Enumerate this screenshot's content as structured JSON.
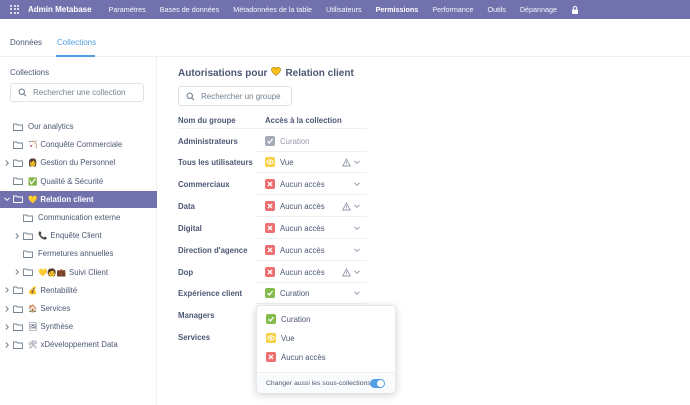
{
  "topnav": {
    "brand": "Admin Metabase",
    "items": [
      "Paramètres",
      "Bases de données",
      "Métadonnées de la table",
      "Utilisateurs",
      "Permissions",
      "Performance",
      "Outils",
      "Dépannage"
    ],
    "active": "Permissions",
    "bg_color": "#7172ad"
  },
  "subtabs": {
    "items": [
      "Données",
      "Collections"
    ],
    "active": "Collections",
    "accent": "#509ee3"
  },
  "sidebar": {
    "title": "Collections",
    "search_placeholder": "Rechercher une collection",
    "items": [
      {
        "label": "Our analytics",
        "emoji": "",
        "expandable": false,
        "level": 0
      },
      {
        "label": "Conquête Commerciale",
        "emoji": "🏹",
        "expandable": false,
        "level": 0
      },
      {
        "label": "Gestion du Personnel",
        "emoji": "👩",
        "expandable": true,
        "level": 0
      },
      {
        "label": "Qualité & Sécurité",
        "emoji": "✅",
        "expandable": false,
        "level": 0
      },
      {
        "label": "Relation client",
        "emoji": "💛",
        "expandable": true,
        "level": 0,
        "selected": true
      },
      {
        "label": "Communication externe",
        "emoji": "",
        "expandable": false,
        "level": 1
      },
      {
        "label": "Enquête Client",
        "emoji": "📞",
        "expandable": true,
        "level": 1
      },
      {
        "label": "Fermetures annuelles",
        "emoji": "",
        "expandable": false,
        "level": 1
      },
      {
        "label": "Suivi Client",
        "emoji": "💛🧑💼",
        "expandable": true,
        "level": 1
      },
      {
        "label": "Rentabilité",
        "emoji": "💰",
        "expandable": true,
        "level": 0
      },
      {
        "label": "Services",
        "emoji": "🏠",
        "expandable": true,
        "level": 0
      },
      {
        "label": "Synthèse",
        "emoji": "🖼",
        "expandable": true,
        "level": 0
      },
      {
        "label": "xDéveloppement Data",
        "emoji": "🛠",
        "expandable": true,
        "level": 0
      }
    ]
  },
  "main": {
    "title_prefix": "Autorisations pour",
    "title_emoji": "💛",
    "title_name": "Relation client",
    "search_placeholder": "Rechercher un groupe",
    "col_group": "Nom du groupe",
    "col_access": "Accès à la collection",
    "rows": [
      {
        "group": "Administrateurs",
        "access": "Curation",
        "type": "curate",
        "disabled": true,
        "warn": false,
        "chevron": false
      },
      {
        "group": "Tous les utilisateurs",
        "access": "Vue",
        "type": "view",
        "disabled": false,
        "warn": true,
        "chevron": true
      },
      {
        "group": "Commerciaux",
        "access": "Aucun accès",
        "type": "none",
        "disabled": false,
        "warn": false,
        "chevron": true
      },
      {
        "group": "Data",
        "access": "Aucun accès",
        "type": "none",
        "disabled": false,
        "warn": true,
        "chevron": true
      },
      {
        "group": "Digital",
        "access": "Aucun accès",
        "type": "none",
        "disabled": false,
        "warn": false,
        "chevron": true
      },
      {
        "group": "Direction d'agence",
        "access": "Aucun accès",
        "type": "none",
        "disabled": false,
        "warn": false,
        "chevron": true
      },
      {
        "group": "Dop",
        "access": "Aucun accès",
        "type": "none",
        "disabled": false,
        "warn": true,
        "chevron": true
      },
      {
        "group": "Expérience client",
        "access": "Curation",
        "type": "curate",
        "disabled": false,
        "warn": false,
        "chevron": true
      },
      {
        "group": "Managers",
        "access": "",
        "type": "",
        "disabled": false,
        "warn": false,
        "chevron": false
      },
      {
        "group": "Services",
        "access": "",
        "type": "",
        "disabled": false,
        "warn": false,
        "chevron": false
      }
    ]
  },
  "dropdown": {
    "options": [
      {
        "label": "Curation",
        "type": "curate"
      },
      {
        "label": "Vue",
        "type": "view"
      },
      {
        "label": "Aucun accès",
        "type": "none"
      }
    ],
    "footer_label": "Changer aussi les sous-collections",
    "toggle_on": true
  },
  "colors": {
    "curate": "#84bb4c",
    "view": "#f9cf48",
    "none": "#ed6e6e",
    "disabled": "#a6acb7"
  }
}
